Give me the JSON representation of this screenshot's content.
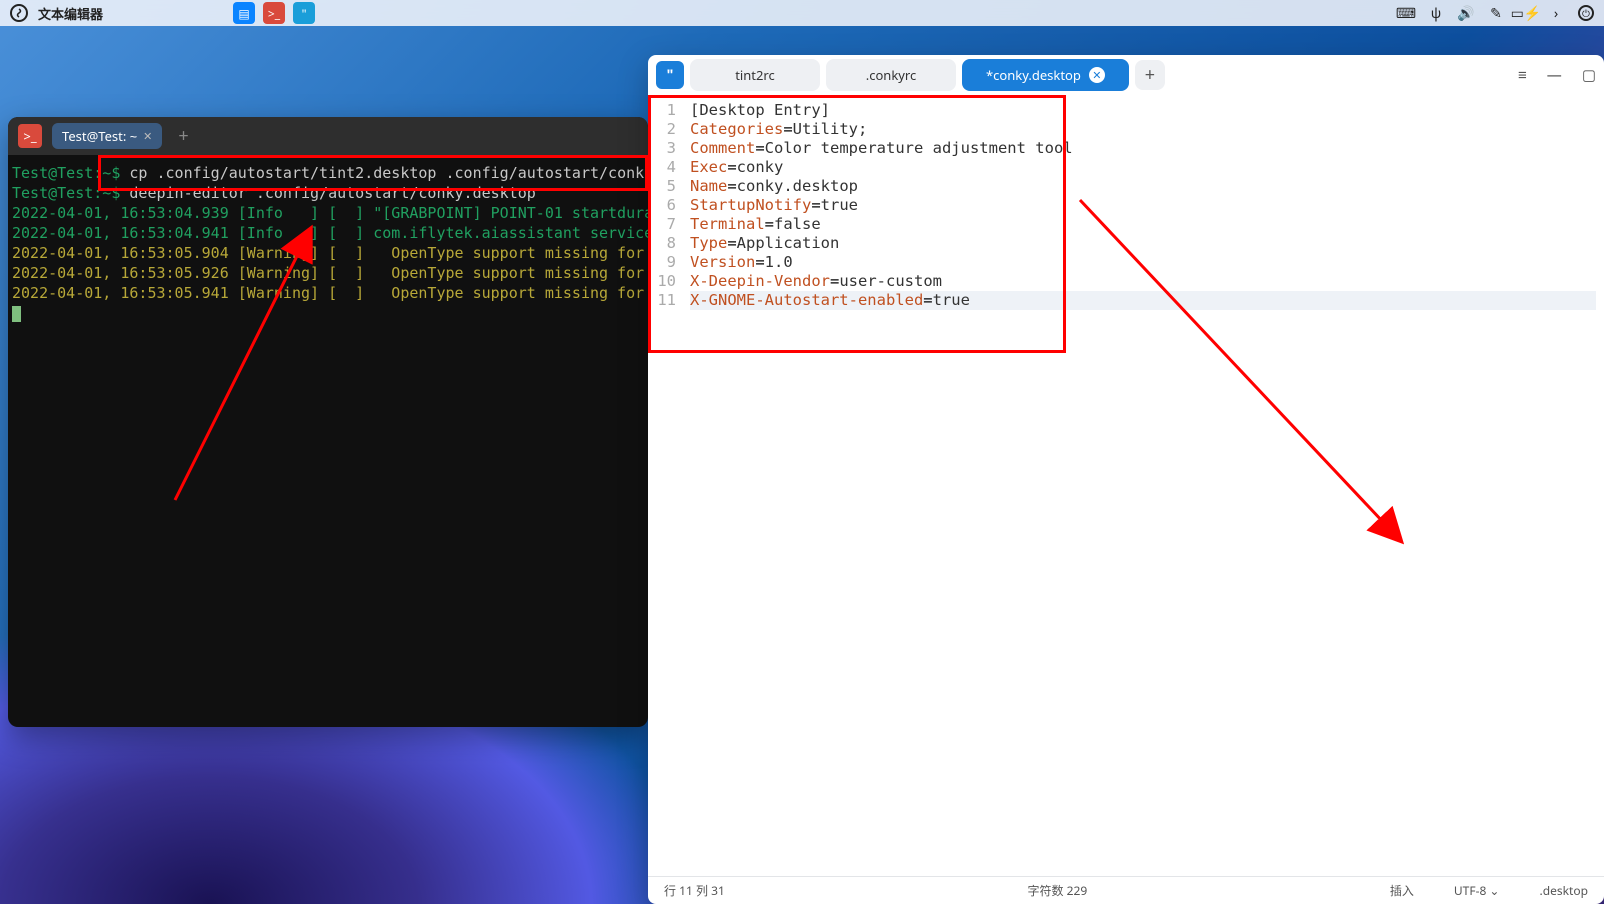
{
  "menubar": {
    "app_name": "文本编辑器"
  },
  "terminal": {
    "tab_title": "Test@Test: ~",
    "lines": [
      {
        "prompt": "Test@Test:~$",
        "cmd": " cp .config/autostart/tint2.desktop .config/autostart/conk"
      },
      {
        "prompt": "Test@Test:~$",
        "cmd": " deepin-editor .config/autostart/conky.desktop"
      },
      {
        "raw": "2022-04-01, 16:53:04.939 [Info   ] [  ] \"[GRABPOINT] POINT-01 startdura",
        "cls": "tinfo"
      },
      {
        "raw": "2022-04-01, 16:53:04.941 [Info   ] [  ] com.iflytek.aiassistant service",
        "cls": "tinfo"
      },
      {
        "raw": "2022-04-01, 16:53:05.904 [Warning] [  ]   OpenType support missing for ",
        "cls": "twarn"
      },
      {
        "raw": "2022-04-01, 16:53:05.926 [Warning] [  ]   OpenType support missing for ",
        "cls": "twarn"
      },
      {
        "raw": "2022-04-01, 16:53:05.941 [Warning] [  ]   OpenType support missing for ",
        "cls": "twarn"
      }
    ]
  },
  "editor": {
    "tabs": [
      {
        "label": "tint2rc",
        "active": false
      },
      {
        "label": ".conkyrc",
        "active": false
      },
      {
        "label": "*conky.desktop",
        "active": true
      }
    ],
    "code": [
      {
        "section": "[Desktop Entry]"
      },
      {
        "key": "Categories",
        "val": "Utility;"
      },
      {
        "key": "Comment",
        "val": "Color temperature adjustment tool"
      },
      {
        "key": "Exec",
        "val": "conky"
      },
      {
        "key": "Name",
        "val": "conky.desktop"
      },
      {
        "key": "StartupNotify",
        "val": "true"
      },
      {
        "key": "Terminal",
        "val": "false"
      },
      {
        "key": "Type",
        "val": "Application"
      },
      {
        "key": "Version",
        "val": "1.0"
      },
      {
        "key": "X-Deepin-Vendor",
        "val": "user-custom"
      },
      {
        "key": "X-GNOME-Autostart-enabled",
        "val": "true"
      }
    ],
    "status": {
      "cursor": "行 11  列 31",
      "chars": "字符数 229",
      "insert": "插入",
      "encoding": "UTF-8",
      "filetype": ".desktop"
    }
  }
}
